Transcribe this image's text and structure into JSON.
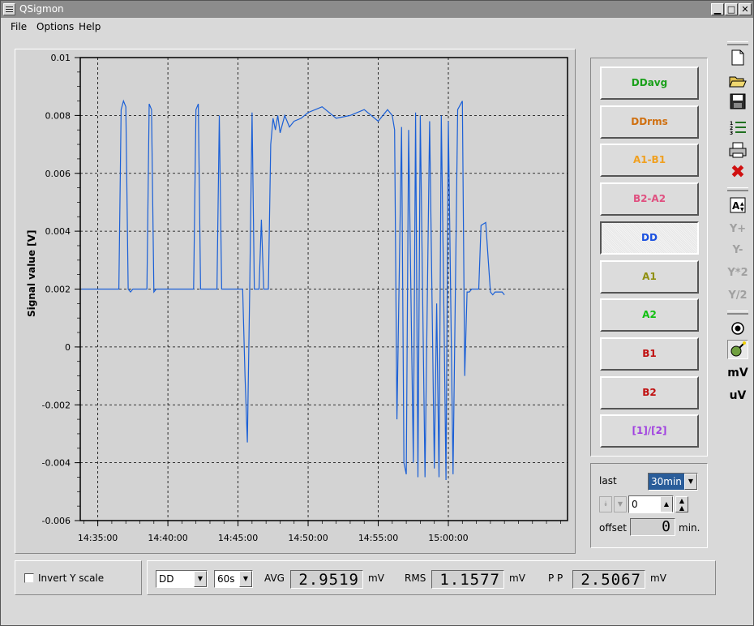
{
  "window": {
    "title": "QSigmon"
  },
  "menu": {
    "file": "File",
    "options": "Options",
    "help": "Help"
  },
  "chart_data": {
    "type": "line",
    "ylabel": "Signal value [V]",
    "xlabel": "",
    "ylim": [
      -0.006,
      0.01
    ],
    "xlim_minutes": [
      "14:33:45",
      "15:08:30"
    ],
    "yticks": [
      "0.01",
      "0.008",
      "0.006",
      "0.004",
      "0.002",
      "0",
      "-0.002",
      "-0.004",
      "-0.006"
    ],
    "xticks": [
      "14:35:00",
      "14:40:00",
      "14:45:00",
      "14:50:00",
      "14:55:00",
      "15:00:00"
    ],
    "grid": true,
    "series": [
      {
        "color": "#1a5fd6",
        "x": [
          "14:33:50",
          "14:36:30",
          "14:36:40",
          "14:36:50",
          "14:37:00",
          "14:37:10",
          "14:37:20",
          "14:37:30",
          "14:38:30",
          "14:38:40",
          "14:38:50",
          "14:39:00",
          "14:39:10",
          "14:41:50",
          "14:42:00",
          "14:42:10",
          "14:42:20",
          "14:42:30",
          "14:43:30",
          "14:43:40",
          "14:43:50",
          "14:44:00",
          "14:44:10",
          "14:45:20",
          "14:45:30",
          "14:45:40",
          "14:45:50",
          "14:46:00",
          "14:46:10",
          "14:46:20",
          "14:46:30",
          "14:46:40",
          "14:46:50",
          "14:47:00",
          "14:47:10",
          "14:47:20",
          "14:47:30",
          "14:47:40",
          "14:47:50",
          "14:48:00",
          "14:48:20",
          "14:48:40",
          "14:49:00",
          "14:49:30",
          "14:50:00",
          "14:51:00",
          "14:52:00",
          "14:53:00",
          "14:54:00",
          "14:55:00",
          "14:55:40",
          "14:56:00",
          "14:56:10",
          "14:56:20",
          "14:56:40",
          "14:56:50",
          "14:57:00",
          "14:57:10",
          "14:57:30",
          "14:57:40",
          "14:57:50",
          "14:58:00",
          "14:58:20",
          "14:58:40",
          "14:59:00",
          "14:59:10",
          "14:59:20",
          "14:59:30",
          "14:59:40",
          "14:59:50",
          "15:00:00",
          "15:00:20",
          "15:00:40",
          "15:01:00",
          "15:01:10",
          "15:01:20",
          "15:01:30",
          "15:01:40",
          "15:02:00",
          "15:02:10",
          "15:02:20",
          "15:02:40",
          "15:03:00",
          "15:03:10",
          "15:03:20",
          "15:03:50",
          "15:04:00"
        ],
        "y": [
          0.002,
          0.002,
          0.0082,
          0.0085,
          0.0083,
          0.002,
          0.0019,
          0.002,
          0.002,
          0.0084,
          0.0082,
          0.0019,
          0.002,
          0.002,
          0.0082,
          0.0084,
          0.002,
          0.002,
          0.002,
          0.008,
          0.002,
          0.002,
          0.002,
          0.002,
          -0.001,
          -0.0033,
          0.002,
          0.0081,
          0.002,
          0.002,
          0.002,
          0.0044,
          0.002,
          0.002,
          0.002,
          0.007,
          0.0079,
          0.0075,
          0.008,
          0.0074,
          0.008,
          0.0076,
          0.0078,
          0.0079,
          0.0081,
          0.0083,
          0.0079,
          0.008,
          0.0082,
          0.0078,
          0.0082,
          0.008,
          0.0075,
          -0.0025,
          0.0076,
          -0.004,
          -0.0044,
          0.0075,
          -0.004,
          0.0081,
          -0.0045,
          0.008,
          -0.0045,
          0.0078,
          -0.0042,
          0.0015,
          -0.0045,
          0.008,
          0.002,
          -0.0046,
          0.0078,
          -0.0044,
          0.0082,
          0.0085,
          -0.001,
          0.0019,
          0.0019,
          0.002,
          0.002,
          0.002,
          0.0042,
          0.0043,
          0.0019,
          0.0018,
          0.0019,
          0.0019,
          0.0018
        ]
      }
    ]
  },
  "channels": [
    {
      "label": "DDavg",
      "color": "#1aa01a"
    },
    {
      "label": "DDrms",
      "color": "#d07010"
    },
    {
      "label": "A1-B1",
      "color": "#f0a020"
    },
    {
      "label": "B2-A2",
      "color": "#e05080"
    },
    {
      "label": "DD",
      "color": "#1a50e0"
    },
    {
      "label": "A1",
      "color": "#909010"
    },
    {
      "label": "A2",
      "color": "#10c010"
    },
    {
      "label": "B1",
      "color": "#c01010"
    },
    {
      "label": "B2",
      "color": "#c01010"
    },
    {
      "label": "[1]/[2]",
      "color": "#a040e0"
    }
  ],
  "time_panel": {
    "last_label": "last",
    "last_value": "30min",
    "spin_value": "0",
    "offset_label": "offset",
    "offset_value": "0",
    "offset_unit": "min."
  },
  "toolbar": {
    "y_plus": "Y+",
    "y_minus": "Y-",
    "y_times2": "Y*2",
    "y_div2": "Y/2",
    "mv": "mV",
    "uv": "uV"
  },
  "bottom": {
    "invert_label": "Invert Y scale",
    "channel_select": "DD",
    "interval_select": "60s",
    "avg_label": "AVG",
    "avg_value": "2.9519",
    "avg_unit": "mV",
    "rms_label": "RMS",
    "rms_value": "1.1577",
    "rms_unit": "mV",
    "pp_label": "P P",
    "pp_value": "2.5067",
    "pp_unit": "mV"
  }
}
